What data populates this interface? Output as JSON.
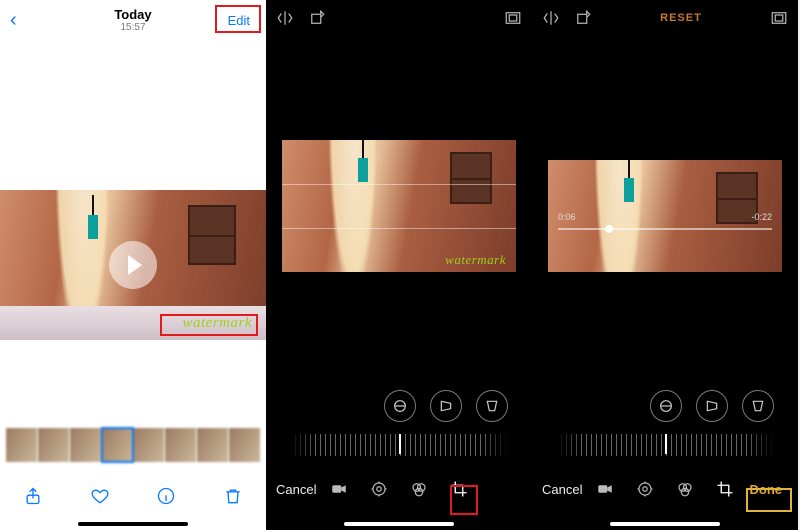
{
  "screen1": {
    "header": {
      "back": "‹",
      "title": "Today",
      "subtitle": "15:57",
      "edit": "Edit"
    },
    "watermark": "watermark",
    "toolbar_icons": {
      "share": "share-icon",
      "favorite": "heart-icon",
      "info": "info-icon",
      "delete": "trash-icon"
    }
  },
  "screen2": {
    "top_icons": {
      "flip": "flip-icon",
      "rotate": "rotate-icon",
      "aspect": "aspect-icon"
    },
    "watermark": "watermark",
    "circles": {
      "straighten": "straighten-icon",
      "perspective_h": "perspective-h-icon",
      "perspective_v": "perspective-v-icon"
    },
    "cancel": "Cancel",
    "tabs": {
      "video": "video-icon",
      "adjust": "adjust-icon",
      "filters": "filters-icon",
      "crop": "crop-icon"
    }
  },
  "screen3": {
    "top_icons": {
      "flip": "flip-icon",
      "rotate": "rotate-icon",
      "aspect": "aspect-icon"
    },
    "reset": "RESET",
    "scrubber": {
      "current": "0:06",
      "remaining": "-0:22"
    },
    "circles": {
      "straighten": "straighten-icon",
      "perspective_h": "perspective-h-icon",
      "perspective_v": "perspective-v-icon"
    },
    "cancel": "Cancel",
    "done": "Done",
    "tabs": {
      "video": "video-icon",
      "adjust": "adjust-icon",
      "filters": "filters-icon",
      "crop": "crop-icon"
    }
  }
}
